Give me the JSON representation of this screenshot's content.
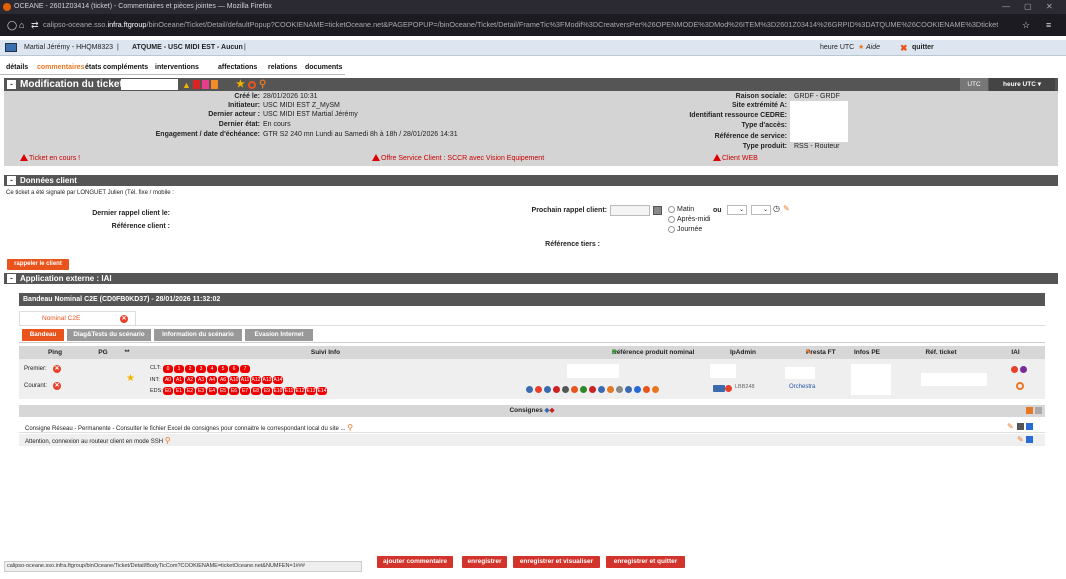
{
  "browser": {
    "title": "OCEANE - 2601Z03414 (ticket) - Commentaires et pièces jointes — Mozilla Firefox",
    "url_pre": "calipso-oceane.sso.",
    "url_host": "infra.ftgroup",
    "url_post": "/binOceane/Ticket/Detail/defaultPopup?COOKIENAME=ticketOceane.net&PAGEPOPUP=/binOceane/Ticket/Detail/FrameTic%3FModif%3DCreatversPer%26OPENMODE%3DMod%26ITEM%3D2601Z03414%26GRPID%3DATQUME%26COOKIENAME%3Dticket"
  },
  "userbar": {
    "user": "Martial Jérémy - HHQM8323",
    "sep1": "|",
    "group": "ATQUME - USC MIDI EST - Aucun",
    "sep2": "|",
    "utc": "heure UTC",
    "help": "Aide",
    "quit": "quitter"
  },
  "tabs": [
    "détails",
    "commentaires",
    "états",
    "compléments",
    "interventions",
    "affectations",
    "relations",
    "documents"
  ],
  "modif": {
    "title": "Modification du ticket",
    "utc_small": "UTC",
    "utc_btn": "heure UTC ▾",
    "left": [
      {
        "label": "Créé le:",
        "value": "28/01/2026 10:31"
      },
      {
        "label": "Initiateur:",
        "value": "USC MIDI EST Z_MySM"
      },
      {
        "label": "Dernier acteur :",
        "value": "USC MIDI EST Martial Jérémy"
      },
      {
        "label": "Dernier état:",
        "value": "En cours"
      },
      {
        "label": "Engagement / date d'échéance:",
        "value": "GTR S2 240 mn Lundi au Samedi 8h à 18h / 28/01/2026 14:31"
      }
    ],
    "right": [
      {
        "label": "Raison sociale:",
        "value": "GRDF - GRDF"
      },
      {
        "label": "Site extrémité A:",
        "value": ""
      },
      {
        "label": "Identifiant ressource CEDRE:",
        "value": ""
      },
      {
        "label": "Type d'accès:",
        "value": ""
      },
      {
        "label": "Référence de service:",
        "value": ""
      },
      {
        "label": "Type produit:",
        "value": "RSS - Routeur"
      }
    ],
    "warnings": [
      "Ticket en cours !",
      "Offre Service Client : SCCR avec Vision Equipement",
      "Client WEB"
    ]
  },
  "client": {
    "header": "Données client",
    "signal": "Ce ticket a été signalé par LONGUET Julien (Tél. fixe / mobile :",
    "dernier_rappel": "Dernier rappel client le:",
    "reference_client": "Référence client :",
    "prochain_rappel": "Prochain rappel client:",
    "ou": "ou",
    "options": [
      "Matin",
      "Après-midi",
      "Journée"
    ],
    "reference_tiers": "Référence tiers :",
    "btn_rappeler": "rappeler le client"
  },
  "iai": {
    "header": "Application externe : IAI",
    "bandeau": "Bandeau Nominal C2E (CD0FB0KD37) - 28/01/2026 11:32:02",
    "tab_nominal": "Nominal C2E",
    "subtabs": [
      "Bandeau",
      "Diag&Tests du scénario",
      "Information du scénario",
      "Evasion Internet"
    ],
    "columns": [
      "Ping",
      "PG",
      "**",
      "Suivi Info",
      "Référence produit nominal",
      "IpAdmin",
      "Presta FT",
      "Infos PE",
      "Réf. ticket",
      "IAI"
    ],
    "premier": "Premier:",
    "courant": "Courant:",
    "clt_label": "CLT:",
    "int_label": "INT:",
    "eds_label": "EDS:",
    "clt": [
      "0",
      "1",
      "2",
      "3",
      "4",
      "5",
      "6",
      "7"
    ],
    "int": [
      "A0",
      "A1",
      "A2",
      "A3",
      "A4",
      "A6",
      "A10",
      "A11",
      "A12",
      "A13",
      "A14"
    ],
    "eds": [
      "E0",
      "E1",
      "E2",
      "E3",
      "E4",
      "E5",
      "E6",
      "E7",
      "E8",
      "E9",
      "E10",
      "E11",
      "E12",
      "E13",
      "E14"
    ],
    "ipadmin_suffix": "LBB248",
    "presta": "Orchestra",
    "consignes": "Consignes",
    "consigne1": "Consigne Réseau - Permanente - Consulter le fichier Excel de consignes pour connaitre le correspondant local du site ...",
    "consigne2": "Attention, connexion au routeur client en mode SSH"
  },
  "footer": {
    "status": "calipso-oceane.sso.infra.ftgroup/binOceane/Ticket/Detail/BodyTicCom?COOKIENAME=ticketOceane.net&NUMFEN=1###",
    "buttons": [
      "ajouter commentaire",
      "enregistrer",
      "enregistrer et visualiser",
      "enregistrer et quitter"
    ]
  }
}
